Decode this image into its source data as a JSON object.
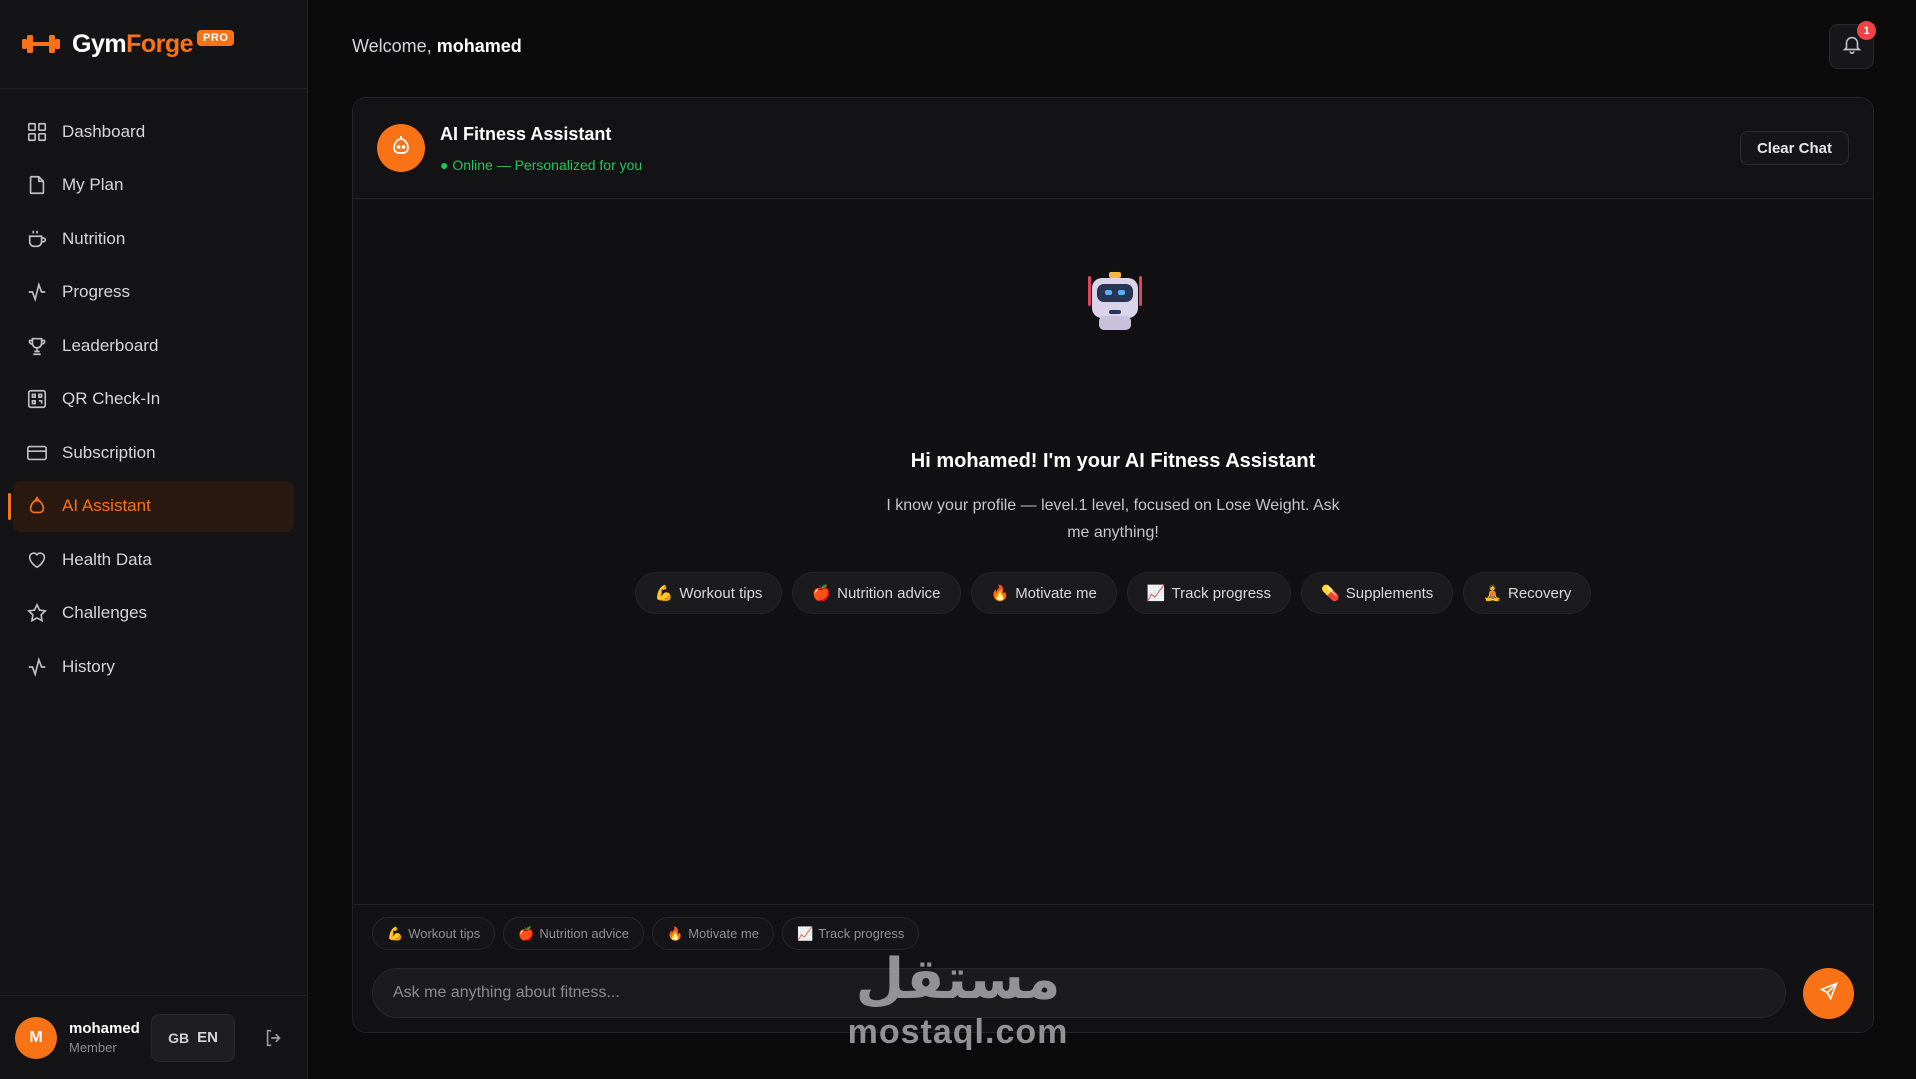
{
  "brand": {
    "name_part1": "Gym",
    "name_part2": "Forge",
    "badge": "PRO"
  },
  "sidebar": {
    "items": [
      {
        "label": "Dashboard",
        "icon": "grid-icon"
      },
      {
        "label": "My Plan",
        "icon": "file-icon"
      },
      {
        "label": "Nutrition",
        "icon": "coffee-icon"
      },
      {
        "label": "Progress",
        "icon": "activity-icon"
      },
      {
        "label": "Leaderboard",
        "icon": "trophy-icon"
      },
      {
        "label": "QR Check-In",
        "icon": "qr-icon"
      },
      {
        "label": "Subscription",
        "icon": "card-icon"
      },
      {
        "label": "AI Assistant",
        "icon": "bot-icon",
        "active": true
      },
      {
        "label": "Health Data",
        "icon": "heart-icon"
      },
      {
        "label": "Challenges",
        "icon": "star-icon"
      },
      {
        "label": "History",
        "icon": "activity-icon"
      }
    ]
  },
  "user": {
    "initial": "M",
    "name": "mohamed",
    "role": "Member",
    "lang_flag": "GB",
    "lang_code": "EN"
  },
  "header": {
    "welcome_prefix": "Welcome, ",
    "username": "mohamed",
    "notification_count": "1"
  },
  "chat": {
    "title": "AI Fitness Assistant",
    "status": "● Online — Personalized for you",
    "clear_label": "Clear Chat",
    "greeting": "Hi mohamed! I'm your AI Fitness Assistant",
    "subtext": "I know your profile — level.1 level, focused on Lose Weight. Ask me anything!",
    "suggestions": [
      {
        "emoji": "💪",
        "label": "Workout tips"
      },
      {
        "emoji": "🍎",
        "label": "Nutrition advice"
      },
      {
        "emoji": "🔥",
        "label": "Motivate me"
      },
      {
        "emoji": "📈",
        "label": "Track progress"
      },
      {
        "emoji": "💊",
        "label": "Supplements"
      },
      {
        "emoji": "🧘",
        "label": "Recovery"
      }
    ],
    "quick_chips": [
      {
        "emoji": "💪",
        "label": "Workout tips"
      },
      {
        "emoji": "🍎",
        "label": "Nutrition advice"
      },
      {
        "emoji": "🔥",
        "label": "Motivate me"
      },
      {
        "emoji": "📈",
        "label": "Track progress"
      }
    ],
    "input_placeholder": "Ask me anything about fitness..."
  },
  "watermark": {
    "arabic": "مستقل",
    "latin": "mostaql.com"
  },
  "colors": {
    "accent": "#f97316",
    "online": "#22c55e",
    "badge": "#ef4444",
    "background": "#0b0b0c"
  }
}
